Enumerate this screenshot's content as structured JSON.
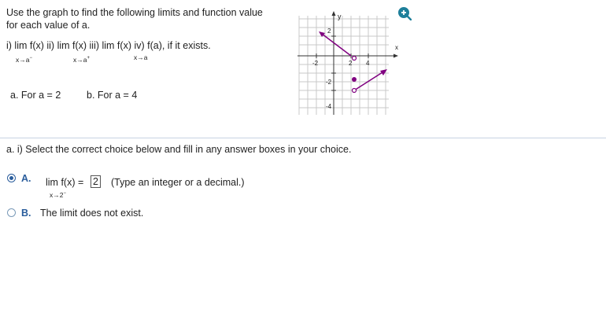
{
  "question": {
    "prompt_line1": "Use the graph to find the following limits and function value",
    "prompt_line2": "for each value of a.",
    "parts_line": "i)  lim  f(x)  ii)  lim  f(x)  iii)  lim  f(x)  iv)  f(a), if it exists.",
    "sub_i": "x→a",
    "sub_i_sup": "−",
    "sub_ii": "x→a",
    "sub_ii_sup": "+",
    "sub_iii": "x→a",
    "case_a": "a.   For a = 2",
    "case_b": "b.   For a = 4"
  },
  "graph": {
    "y_label": "y",
    "x_label": "x",
    "tick_x_neg2": "-2",
    "tick_x_2": "2",
    "tick_x_4": "4",
    "tick_y_2": "2",
    "tick_y_neg2": "-2",
    "tick_y_neg4": "-4",
    "curve_color": "#800080",
    "zoom_icon": "zoom-in-icon"
  },
  "part_a": {
    "instruction": "a.  i) Select the correct choice below and fill in any answer boxes in your choice.",
    "choice_a_letter": "A.",
    "choice_a_lim": "lim  f(x) =",
    "choice_a_sub": "x→2",
    "choice_a_sub_sup": "−",
    "choice_a_answer": "2",
    "choice_a_hint": "(Type an integer or a decimal.)",
    "choice_b_letter": "B.",
    "choice_b_text": "The limit does not exist."
  }
}
